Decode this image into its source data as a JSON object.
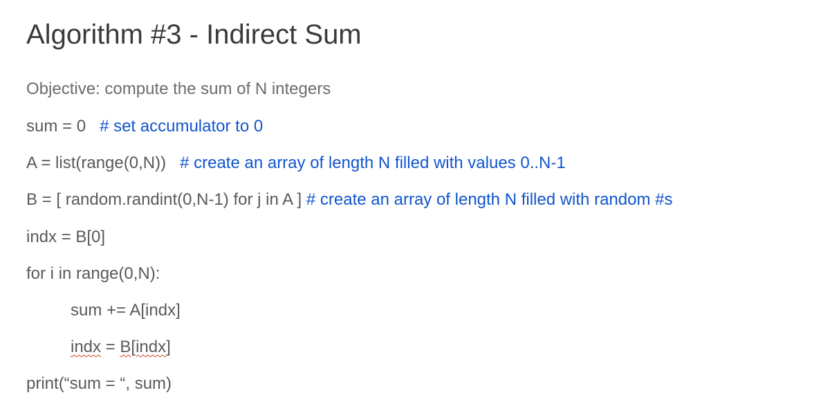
{
  "title": "Algorithm #3 - Indirect Sum",
  "objective": "Objective: compute the sum of N integers",
  "lines": {
    "l1": {
      "code": "sum = 0",
      "gap": "   ",
      "comment": "# set accumulator to 0"
    },
    "l2": {
      "code": "A = list(range(0,N))",
      "gap": "   ",
      "comment": "# create an array of length N filled with values 0..N-1"
    },
    "l3": {
      "code": "B = [ random.randint(0,N-1) for j in A ] ",
      "comment": "# create an array of length N filled with random #s"
    },
    "l4": {
      "code": "indx = B[0]"
    },
    "l5": {
      "code": "for i in range(0,N):"
    },
    "l6": {
      "code": "sum += A[indx]"
    },
    "l7": {
      "p1": "indx",
      "p2": " = ",
      "p3": "B[indx",
      "p4": "]"
    },
    "l8": {
      "code": "print(“sum = “, sum)"
    }
  }
}
